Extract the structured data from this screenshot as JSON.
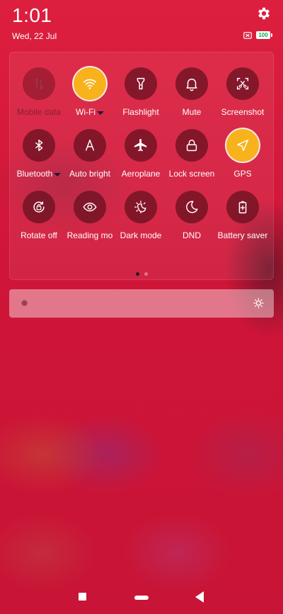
{
  "status": {
    "time": "1:01",
    "date": "Wed, 22 Jul",
    "battery_level": "100",
    "icons": [
      "gear-icon",
      "sim-card-icon",
      "battery-icon"
    ],
    "battery_color": "#1aa34a"
  },
  "tiles": [
    {
      "label": "Mobile data",
      "icon": "mobile-data-icon",
      "state": "disabled",
      "has_caret": false
    },
    {
      "label": "Wi-Fi",
      "icon": "wifi-icon",
      "state": "on",
      "has_caret": true
    },
    {
      "label": "Flashlight",
      "icon": "flashlight-icon",
      "state": "off",
      "has_caret": false
    },
    {
      "label": "Mute",
      "icon": "bell-icon",
      "state": "off",
      "has_caret": false
    },
    {
      "label": "Screenshot",
      "icon": "screenshot-icon",
      "state": "off",
      "has_caret": false
    },
    {
      "label": "Bluetooth",
      "icon": "bluetooth-icon",
      "state": "off",
      "has_caret": true
    },
    {
      "label": "Auto bright",
      "icon": "auto-brightness-icon",
      "state": "off",
      "has_caret": false
    },
    {
      "label": "Aeroplane",
      "icon": "airplane-icon",
      "state": "off",
      "has_caret": false
    },
    {
      "label": "Lock screen",
      "icon": "lock-icon",
      "state": "off",
      "has_caret": false
    },
    {
      "label": "GPS",
      "icon": "location-arrow-icon",
      "state": "on",
      "has_caret": false
    },
    {
      "label": "Rotate off",
      "icon": "rotate-lock-icon",
      "state": "off",
      "has_caret": false
    },
    {
      "label": "Reading mo",
      "icon": "eye-icon",
      "state": "off",
      "has_caret": false
    },
    {
      "label": "Dark mode",
      "icon": "dark-mode-icon",
      "state": "off",
      "has_caret": false
    },
    {
      "label": "DND",
      "icon": "moon-icon",
      "state": "off",
      "has_caret": false
    },
    {
      "label": "Battery saver",
      "icon": "battery-saver-icon",
      "state": "off",
      "has_caret": false
    }
  ],
  "pager": {
    "pages": 2,
    "active": 0
  },
  "brightness": {
    "low_icon": "brightness-low-icon",
    "high_icon": "brightness-high-icon"
  },
  "nav": {
    "icons": [
      "recents-icon",
      "home-icon",
      "back-icon"
    ]
  },
  "colors": {
    "accent_on": "#f7b21c",
    "background": "#d41a3c"
  }
}
